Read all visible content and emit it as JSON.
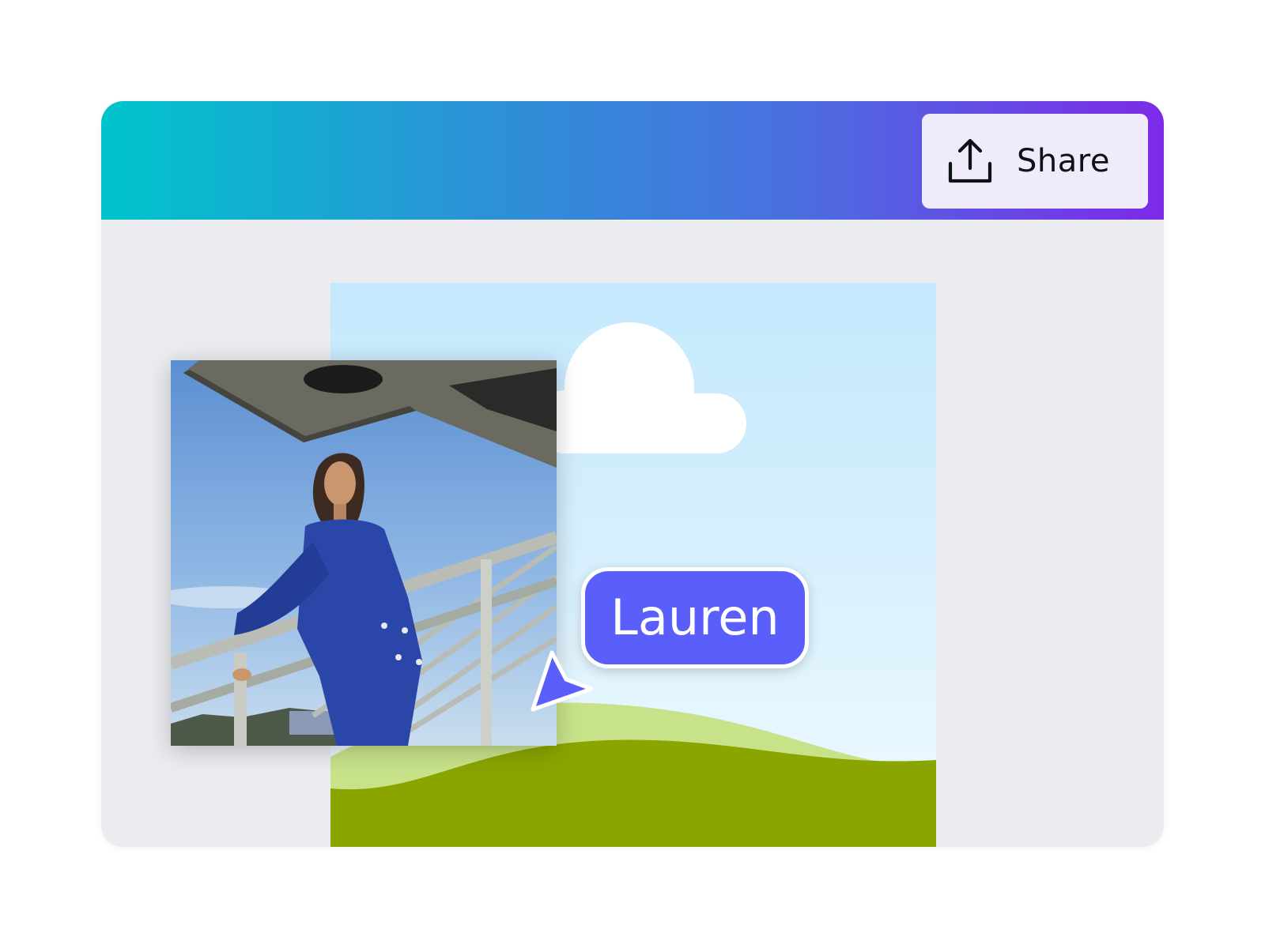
{
  "toolbar": {
    "share_label": "Share",
    "share_icon": "upload-icon"
  },
  "collaborator": {
    "name": "Lauren",
    "color": "#5a5ffc",
    "cursor_icon": "pointer-cursor-icon"
  },
  "colors": {
    "gradient_start": "#00c4cc",
    "gradient_end": "#7d2ae8",
    "share_button_bg": "#f0ebfa",
    "workspace_bg": "#ebecf0",
    "sky": "#c4e8fd",
    "light_grass": "#c8e28a",
    "dark_grass": "#8aa500",
    "jacket": "#2a46a8"
  }
}
